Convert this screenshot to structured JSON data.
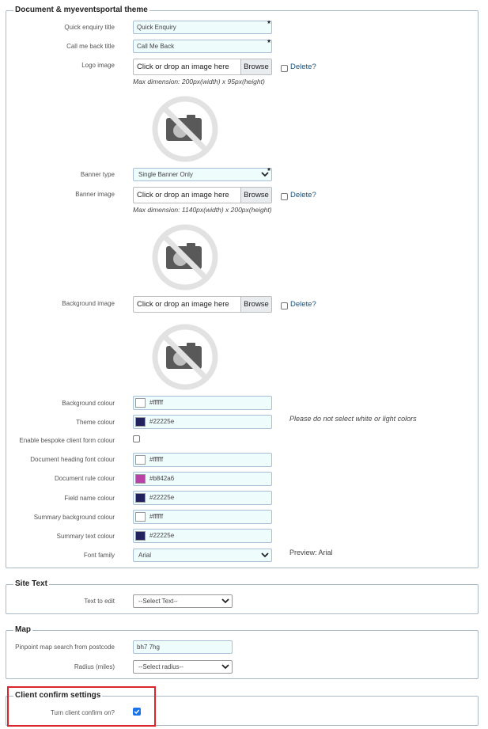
{
  "theme_section": {
    "legend": "Document & myeventsportal theme",
    "quick_enquiry_title": {
      "label": "Quick enquiry title",
      "value": "Quick Enquiry",
      "required_mark": "*"
    },
    "call_me_back_title": {
      "label": "Call me back title",
      "value": "Call Me Back",
      "required_mark": "*"
    },
    "logo_image": {
      "label": "Logo image",
      "drop_text": "Click or drop an image here",
      "browse": "Browse",
      "delete": "Delete?",
      "hint": "Max dimension: 200px(width) x 95px(height)"
    },
    "banner_type": {
      "label": "Banner type",
      "value": "Single Banner Only",
      "required_mark": "*"
    },
    "banner_image": {
      "label": "Banner image",
      "drop_text": "Click or drop an image here",
      "browse": "Browse",
      "delete": "Delete?",
      "hint": "Max dimension: 1140px(width) x 200px(height)"
    },
    "background_image": {
      "label": "Background image",
      "drop_text": "Click or drop an image here",
      "browse": "Browse",
      "delete": "Delete?"
    },
    "background_colour": {
      "label": "Background colour",
      "value": "#ffffff",
      "swatch": "#ffffff"
    },
    "theme_colour": {
      "label": "Theme colour",
      "value": "#22225e",
      "swatch": "#22225e",
      "note": "Please do not select white or light colors"
    },
    "bespoke_client_form_colour": {
      "label": "Enable bespoke client form colour",
      "checked": false
    },
    "document_heading_font_colour": {
      "label": "Document heading font colour",
      "value": "#ffffff",
      "swatch": "#ffffff"
    },
    "document_rule_colour": {
      "label": "Document rule colour",
      "value": "#b842a6",
      "swatch": "#b842a6"
    },
    "field_name_colour": {
      "label": "Field name colour",
      "value": "#22225e",
      "swatch": "#22225e"
    },
    "summary_background_colour": {
      "label": "Summary background colour",
      "value": "#ffffff",
      "swatch": "#ffffff"
    },
    "summary_text_colour": {
      "label": "Summary text colour",
      "value": "#22225e",
      "swatch": "#22225e"
    },
    "font_family": {
      "label": "Font family",
      "value": "Arial",
      "preview": "Preview: Arial"
    }
  },
  "site_text_section": {
    "legend": "Site Text",
    "text_to_edit": {
      "label": "Text to edit",
      "value": "--Select Text--"
    }
  },
  "map_section": {
    "legend": "Map",
    "postcode": {
      "label": "Pinpoint map search from postcode",
      "value": "bh7 7hg"
    },
    "radius": {
      "label": "Radius (miles)",
      "value": "--Select radius--"
    }
  },
  "client_confirm_section": {
    "legend": "Client confirm settings",
    "turn_on": {
      "label": "Turn client confirm on?",
      "checked": true
    }
  },
  "colors": {
    "accent": "#1a73e8",
    "highlight": "#d9262c",
    "field_bg": "#eefcfc"
  },
  "icons": {
    "placeholder": "no-image-icon",
    "dropdown": "chevron-down-icon",
    "checkmark": "checkmark-icon"
  }
}
